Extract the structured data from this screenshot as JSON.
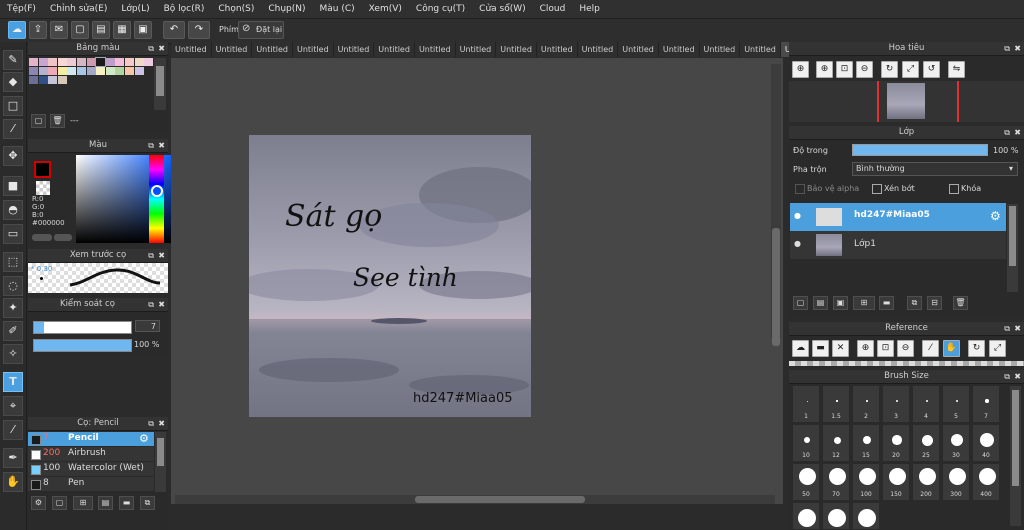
{
  "menu": [
    "Tệp(F)",
    "Chỉnh sửa(E)",
    "Lớp(L)",
    "Bộ lọc(R)",
    "Chọn(S)",
    "Chụp(N)",
    "Màu (C)",
    "Xem(V)",
    "Công cụ(T)",
    "Cửa sổ(W)",
    "Cloud",
    "Help"
  ],
  "toolbar": {
    "key_label": "Phím",
    "reset_label": "Đặt lại"
  },
  "tabs": [
    "Untitled",
    "Untitled",
    "Untitled",
    "Untitled",
    "Untitled",
    "Untitled",
    "Untitled",
    "Untitled",
    "Untitled",
    "Untitled",
    "Untitled",
    "Untitled",
    "Untitled",
    "Untitled",
    "Untitled",
    "Untitled"
  ],
  "palette": {
    "title": "Bảng màu",
    "footer_text": "---",
    "row1": [
      "#e4b3c9",
      "#c9a5d2",
      "#f1c5c5",
      "#f7d6d6",
      "#eecbd4",
      "#d6b6c3",
      "#cf9bb1",
      "#1a1a1a",
      "#be9ec8",
      "#f3bcd9",
      "#f6c8c8",
      "#efd9c6",
      "#efc9e0"
    ],
    "row2": [
      "#8d86b4",
      "#b4b2ce",
      "#f0a9b6",
      "#f5eda4",
      "#cfe9f3",
      "#a7c6e6",
      "#a3a8c9",
      "#f6f0c2",
      "#d0e8c4",
      "#b2d5a0",
      "#f5c7a7",
      "#cec1e6"
    ],
    "row3": [
      "#6a6f97",
      "#325088",
      "#c5c4d8",
      "#d7c8b7"
    ]
  },
  "color": {
    "title": "Màu",
    "r": "R:0",
    "g": "G:0",
    "b": "B:0",
    "hex": "#000000"
  },
  "brush_preview": {
    "title": "Xem trước cọ",
    "size": "0.30"
  },
  "brush_control": {
    "title": "Kiểm soát cọ",
    "size_value": "7",
    "opacity_value": "100 %"
  },
  "brush_list": {
    "title": "Cọ: Pencil",
    "items": [
      {
        "size": "7",
        "name": "Pencil",
        "color": "#1a1a1a"
      },
      {
        "size": "200",
        "name": "Airbrush",
        "color": "#ffffff"
      },
      {
        "size": "100",
        "name": "Watercolor (Wet)",
        "color": "#73d0ff"
      },
      {
        "size": "8",
        "name": "Pen",
        "color": "#1a1a1a"
      }
    ]
  },
  "artwork": {
    "line1": "Sát gọ",
    "line2": "See tình",
    "signature": "hd247#Miaa05"
  },
  "navigator": {
    "title": "Hoa tiêu"
  },
  "layers": {
    "title": "Lớp",
    "opacity_label": "Độ trong",
    "opacity_value": "100 %",
    "opacity_fraction": 1.0,
    "blend_label": "Pha trộn",
    "blend_value": "Bình thường",
    "protect_alpha": "Bảo vệ alpha",
    "clipping": "Xén bớt",
    "lock": "Khóa",
    "items": [
      {
        "name": "hd247#Miaa05"
      },
      {
        "name": "Lớp1"
      }
    ]
  },
  "reference": {
    "title": "Reference"
  },
  "brush_size": {
    "title": "Brush Size",
    "row1": [
      "1",
      "1.5",
      "2",
      "3",
      "4",
      "5",
      "7"
    ],
    "row2": [
      "10",
      "12",
      "15",
      "20",
      "25",
      "30",
      "40"
    ],
    "row3": [
      "50",
      "70",
      "100",
      "150",
      "200",
      "300",
      "400"
    ]
  }
}
